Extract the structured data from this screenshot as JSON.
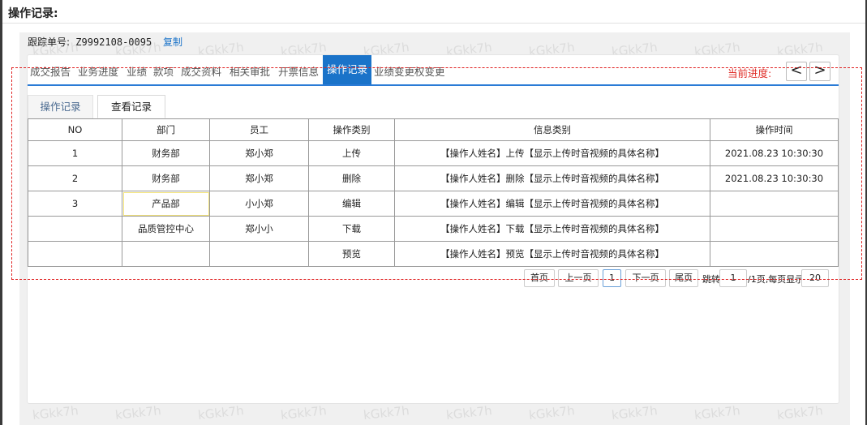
{
  "page": {
    "title": "操作记录:"
  },
  "tracking": {
    "label": "跟踪单号:",
    "number": "Z9992108-0095",
    "copy_label": "复制"
  },
  "tabs": [
    {
      "label": "成交报告"
    },
    {
      "label": "业务进度"
    },
    {
      "label": "业绩"
    },
    {
      "label": "款项"
    },
    {
      "label": "成交资料"
    },
    {
      "label": "相关审批"
    },
    {
      "label": "开票信息"
    },
    {
      "label": "操作记录"
    },
    {
      "label": "业绩变更权变更"
    }
  ],
  "progress": {
    "label": "当前进度:",
    "prev": "<",
    "next": ">"
  },
  "subtabs": {
    "record": "操作记录",
    "view": "查看记录"
  },
  "table": {
    "headers": [
      "NO",
      "部门",
      "员工",
      "操作类别",
      "信息类别",
      "操作时间"
    ],
    "rows": [
      [
        "1",
        "财务部",
        "郑小郑",
        "上传",
        "【操作人姓名】上传【显示上传时音视频的具体名称】",
        "2021.08.23  10:30:30"
      ],
      [
        "2",
        "财务部",
        "郑小郑",
        "删除",
        "【操作人姓名】删除【显示上传时音视频的具体名称】",
        "2021.08.23  10:30:30"
      ],
      [
        "3",
        "产品部",
        "小小郑",
        "编辑",
        "【操作人姓名】编辑【显示上传时音视频的具体名称】",
        ""
      ],
      [
        "",
        "品质管控中心",
        "郑小小",
        "下载",
        "【操作人姓名】下载【显示上传时音视频的具体名称】",
        ""
      ],
      [
        "",
        "",
        "",
        "预览",
        "【操作人姓名】预览【显示上传时音视频的具体名称】",
        ""
      ]
    ]
  },
  "pager": {
    "first": "首页",
    "prev": "上一页",
    "current": "1",
    "next": "下一页",
    "last": "尾页",
    "jump_label": "跳转",
    "jump_value": "1",
    "pages_text": "/1页,每页显示",
    "page_size": "20"
  },
  "watermark": {
    "text": "kGkk7h"
  }
}
